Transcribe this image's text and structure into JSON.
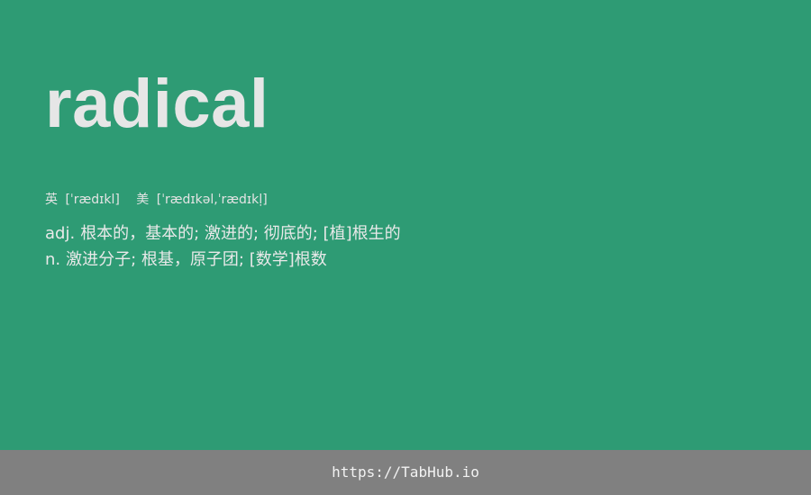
{
  "theme": {
    "background": "#2e9b74",
    "text": "#e6e6e6",
    "footer_background": "#808080"
  },
  "entry": {
    "word": "radical",
    "phonetics": {
      "uk_label": "英",
      "uk_ipa": "[ˈrædɪkl]",
      "us_label": "美",
      "us_ipa": "[ˈrædɪkəl,ˈrædɪkḷ]"
    },
    "definitions": [
      {
        "pos": "adj.",
        "meaning": "根本的，基本的; 激进的; 彻底的; [植]根生的"
      },
      {
        "pos": "n.",
        "meaning": "激进分子; 根基，原子团; [数学]根数"
      }
    ]
  },
  "footer": {
    "link_text": "https://TabHub.io"
  }
}
